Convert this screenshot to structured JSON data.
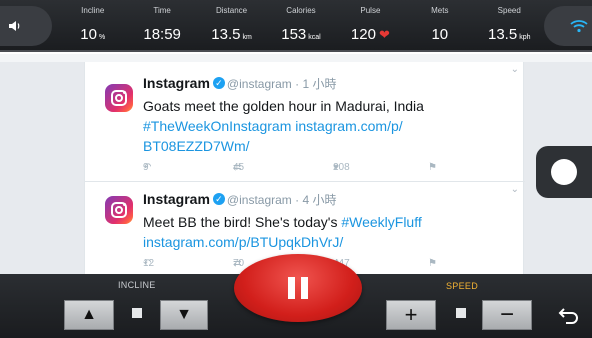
{
  "stats": [
    {
      "label": "Incline",
      "value": "10",
      "unit": "%"
    },
    {
      "label": "Time",
      "value": "18:59",
      "unit": ""
    },
    {
      "label": "Distance",
      "value": "13.5",
      "unit": "km"
    },
    {
      "label": "Calories",
      "value": "153",
      "unit": "kcal"
    },
    {
      "label": "Pulse",
      "value": "120",
      "unit": ""
    },
    {
      "label": "Mets",
      "value": "10",
      "unit": ""
    },
    {
      "label": "Speed",
      "value": "13.5",
      "unit": "kph"
    }
  ],
  "feed": {
    "tweets": [
      {
        "name": "Instagram",
        "handle": "@instagram · 1 小時",
        "text": "Goats meet the golden hour in Madurai, India",
        "link1": "#TheWeekOnInstagram instagram.com/p/",
        "link2": "BT08EZZD7Wm/",
        "replies": "9",
        "retweets": "45",
        "likes": "208"
      },
      {
        "name": "Instagram",
        "handle": "@instagram · 4 小時",
        "text": "Meet BB the bird! She's today's ",
        "hashtag": "#WeeklyFluff",
        "link1": "instagram.com/p/BTUpqkDhVrJ/",
        "replies": "12",
        "retweets": "70",
        "likes": "447"
      }
    ]
  },
  "controls": {
    "incline_label": "INCLINE",
    "speed_label": "SPEED",
    "incline_up": "▲",
    "incline_down": "▼",
    "speed_plus": "+",
    "speed_minus": "−"
  },
  "colors": {
    "accent_red": "#d21f1b",
    "speed_label": "#f2b233",
    "link": "#1b95e0"
  },
  "icons": [
    "speaker-icon",
    "wifi-icon",
    "heart-icon",
    "instagram-icon",
    "verified-icon",
    "reply-icon",
    "retweet-icon",
    "like-icon",
    "dm-icon",
    "pause-icon",
    "back-icon"
  ]
}
